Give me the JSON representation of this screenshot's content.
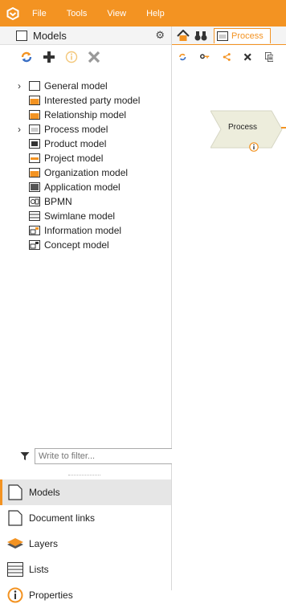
{
  "menubar": {
    "items": [
      "File",
      "Tools",
      "View",
      "Help"
    ]
  },
  "models_panel": {
    "title": "Models",
    "toolbar": [
      "refresh-icon",
      "plus-icon",
      "info-icon",
      "close-icon"
    ],
    "tree": [
      {
        "label": "General model",
        "expandable": true,
        "icon": "doc-icon"
      },
      {
        "label": "Interested party model",
        "expandable": false,
        "icon": "folder-icon"
      },
      {
        "label": "Relationship model",
        "expandable": false,
        "icon": "folder-icon"
      },
      {
        "label": "Process model",
        "expandable": true,
        "icon": "process-doc-icon"
      },
      {
        "label": "Product model",
        "expandable": false,
        "icon": "product-icon"
      },
      {
        "label": "Project model",
        "expandable": false,
        "icon": "project-icon"
      },
      {
        "label": "Organization model",
        "expandable": false,
        "icon": "folder-icon"
      },
      {
        "label": "Application model",
        "expandable": false,
        "icon": "application-icon"
      },
      {
        "label": "BPMN",
        "expandable": false,
        "icon": "bpmn-icon"
      },
      {
        "label": "Swimlane model",
        "expandable": false,
        "icon": "swimlane-icon"
      },
      {
        "label": "Information model",
        "expandable": false,
        "icon": "information-icon"
      },
      {
        "label": "Concept model",
        "expandable": false,
        "icon": "concept-icon"
      }
    ],
    "filter_placeholder": "Write to filter..."
  },
  "nav": [
    {
      "label": "Models",
      "icon": "document-icon",
      "active": true
    },
    {
      "label": "Document links",
      "icon": "document-link-icon",
      "active": false
    },
    {
      "label": "Layers",
      "icon": "layers-icon",
      "active": false
    },
    {
      "label": "Lists",
      "icon": "lists-icon",
      "active": false
    },
    {
      "label": "Properties",
      "icon": "properties-icon",
      "active": false
    }
  ],
  "editor": {
    "tab_label": "Process",
    "shape_label": "Process"
  },
  "colors": {
    "accent": "#f39322",
    "shape_fill": "#ededdc"
  }
}
